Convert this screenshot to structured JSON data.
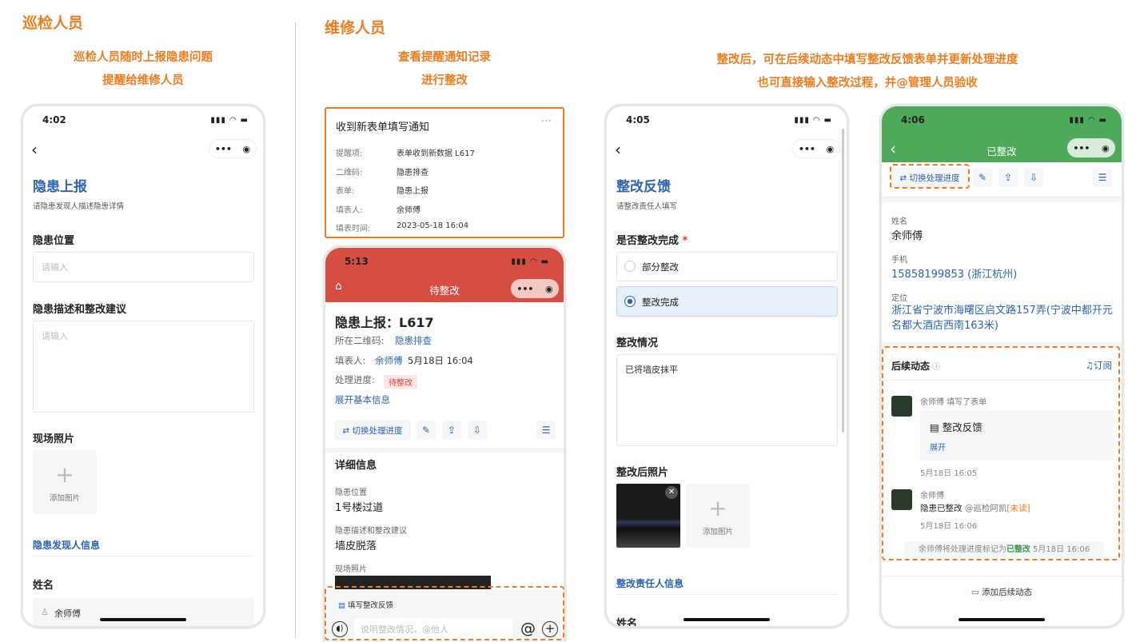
{
  "sections": {
    "inspector": {
      "title": "巡检人员",
      "caption1": "巡检人员随时上报隐患问题",
      "caption2": "提醒给维修人员"
    },
    "repair": {
      "title": "维修人员",
      "caption1": "查看提醒通知记录",
      "caption2": "进行整改"
    },
    "after": {
      "caption1": "整改后，可在后续动态中填写整改反馈表单并更新处理进度",
      "caption2": "也可直接输入整改过程，并@管理人员验收"
    }
  },
  "phone1": {
    "time": "4:02",
    "status_icons": "▮▮▮ ◠ ▬",
    "capsule_more": "•••",
    "capsule_close": "◉",
    "form_title": "隐患上报",
    "form_desc": "请隐患发现人描述隐患详情",
    "field_location": "隐患位置",
    "field_location_placeholder": "请输入",
    "field_desc": "隐患描述和整改建议",
    "field_desc_placeholder": "请输入",
    "field_photo": "现场照片",
    "add_photo": "添加图片",
    "reporter_section": "隐患发现人信息",
    "field_name": "姓名",
    "name_value": "余师傅"
  },
  "notice": {
    "title": "收到新表单填写通知",
    "more": "···",
    "rows": [
      {
        "label": "提醒项:",
        "value": "表单收到新数据 L617"
      },
      {
        "label": "二维码:",
        "value": "隐患排查"
      },
      {
        "label": "表单:",
        "value": "隐患上报"
      },
      {
        "label": "填表人:",
        "value": "余师傅"
      },
      {
        "label": "填表时间:",
        "value": "2023-05-18 16:04"
      }
    ]
  },
  "phone2": {
    "time": "5:13",
    "status_icons": "▮▮▮ ◠ ▬",
    "header_title": "待整改",
    "header_color": "#d64d42",
    "record_title": "隐患上报：L617",
    "qr_label": "所在二维码:",
    "qr_value": "隐患排查",
    "filler_label": "填表人:",
    "filler_name": "余师傅",
    "filler_time": "5月18日 16:04",
    "progress_label": "处理进度:",
    "progress_value": "待整改",
    "expand_basic": "展开基本信息",
    "switch_progress": "⇄ 切换处理进度",
    "detail_title": "详细信息",
    "loc_label": "隐患位置",
    "loc_value": "1号楼过道",
    "desc_label": "隐患描述和整改建议",
    "desc_value": "墙皮脱落",
    "photo_label": "现场照片",
    "fill_feedback": "填写整改反馈",
    "input_placeholder": "说明整改情况，@他人",
    "at_sign": "@",
    "plus_sign": "+"
  },
  "phone3": {
    "time": "4:05",
    "status_icons": "▮▮▮ ◠ ▬",
    "form_title": "整改反馈",
    "form_desc": "请整改责任人填写",
    "q_done": "是否整改完成",
    "required": "*",
    "opt1": "部分整改",
    "opt2": "整改完成",
    "situation_label": "整改情况",
    "situation_value": "已将墙皮抹平",
    "after_photo_label": "整改后照片",
    "add_photo": "添加图片",
    "responsible_section": "整改责任人信息",
    "field_name": "姓名"
  },
  "phone4": {
    "time": "4:06",
    "status_icons": "▮▮▮ ◠ ▬",
    "header_title": "已整改",
    "header_color": "#4daa5a",
    "switch_progress": "⇄ 切换处理进度",
    "name_label": "姓名",
    "name_value": "余师傅",
    "phone_label": "手机",
    "phone_value": "15858199853 (浙江杭州)",
    "loc_label": "定位",
    "loc_value": "浙江省宁波市海曙区启文路157弄(宁波中都开元名都大酒店西南163米)",
    "followup_title": "后续动态",
    "subscribe": "订阅",
    "entry1_user": "余师傅",
    "entry1_action": "填写了表单",
    "entry1_card_title": "整改反馈",
    "entry1_expand": "展开",
    "entry1_time": "5月18日 16:05",
    "entry2_user": "余师傅",
    "entry2_text": "隐患已整改",
    "entry2_mention": "@巡检阿凯",
    "entry2_unread": "[未读]",
    "entry2_time": "5月18日 16:06",
    "log_user": "余师傅",
    "log_mid": "将处理进度标记为",
    "log_status": "已整改",
    "log_time": "5月18日 16:06",
    "add_followup": "添加后续动态"
  }
}
